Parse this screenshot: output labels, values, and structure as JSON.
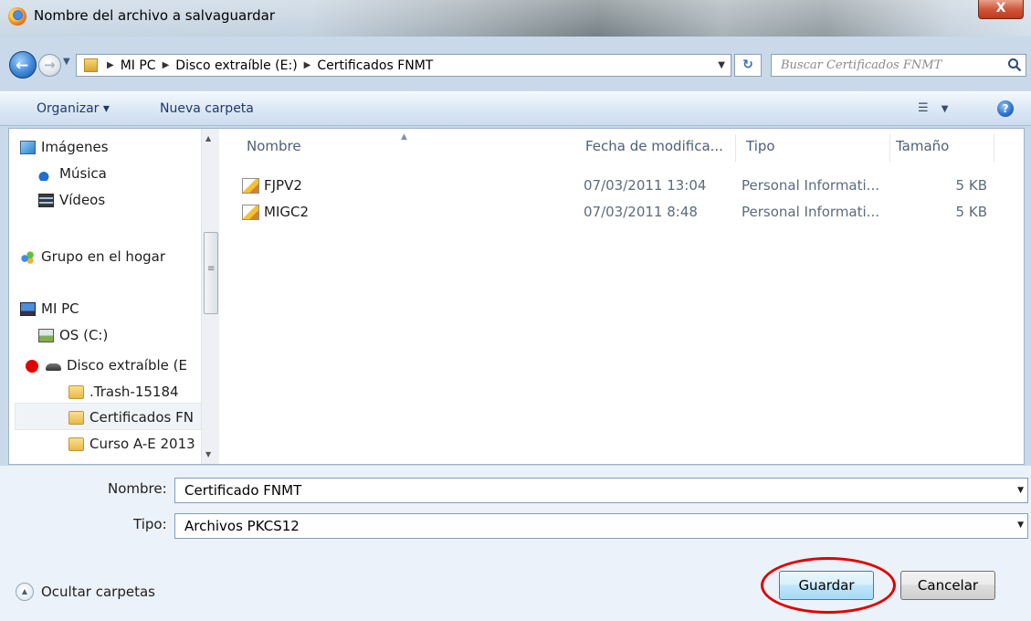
{
  "window": {
    "title": "Nombre del archivo a salvaguardar",
    "close_label": "X"
  },
  "address": {
    "crumbs": [
      "MI PC",
      "Disco extraíble (E:)",
      "Certificados FNMT"
    ],
    "search_placeholder": "Buscar Certificados FNMT"
  },
  "toolbar": {
    "organize_label": "Organizar ▾",
    "new_folder_label": "Nueva carpeta",
    "help_label": "?"
  },
  "navigation": {
    "items": [
      {
        "label": "Imágenes",
        "icon": "pictures-icon"
      },
      {
        "label": "Música",
        "icon": "music-icon"
      },
      {
        "label": "Vídeos",
        "icon": "video-icon"
      },
      {
        "label": "Grupo en el hogar",
        "icon": "homegroup-icon"
      },
      {
        "label": "MI PC",
        "icon": "computer-icon"
      },
      {
        "label": "OS (C:)",
        "icon": "drive-icon"
      },
      {
        "label": "Disco extraíble (E",
        "icon": "usb-drive-icon"
      },
      {
        "label": ".Trash-15184",
        "icon": "folder-icon"
      },
      {
        "label": "Certificados FN",
        "icon": "folder-icon",
        "selected": true
      },
      {
        "label": "Curso A-E 2013",
        "icon": "folder-icon"
      }
    ]
  },
  "filelist": {
    "columns": [
      "Nombre",
      "Fecha de modifica...",
      "Tipo",
      "Tamaño"
    ],
    "rows": [
      {
        "name": "FJPV2",
        "date": "07/03/2011 13:04",
        "type": "Personal Informati...",
        "size": "5 KB"
      },
      {
        "name": "MIGC2",
        "date": "07/03/2011 8:48",
        "type": "Personal Informati...",
        "size": "5 KB"
      }
    ]
  },
  "form": {
    "name_label": "Nombre:",
    "name_value": "Certificado FNMT",
    "type_label": "Tipo:",
    "type_value": "Archivos PKCS12",
    "hide_folders_label": "Ocultar carpetas",
    "save_label": "Guardar",
    "cancel_label": "Cancelar"
  },
  "colors": {
    "highlight_circle": "#e00000",
    "usb_marker": "#e40000"
  }
}
